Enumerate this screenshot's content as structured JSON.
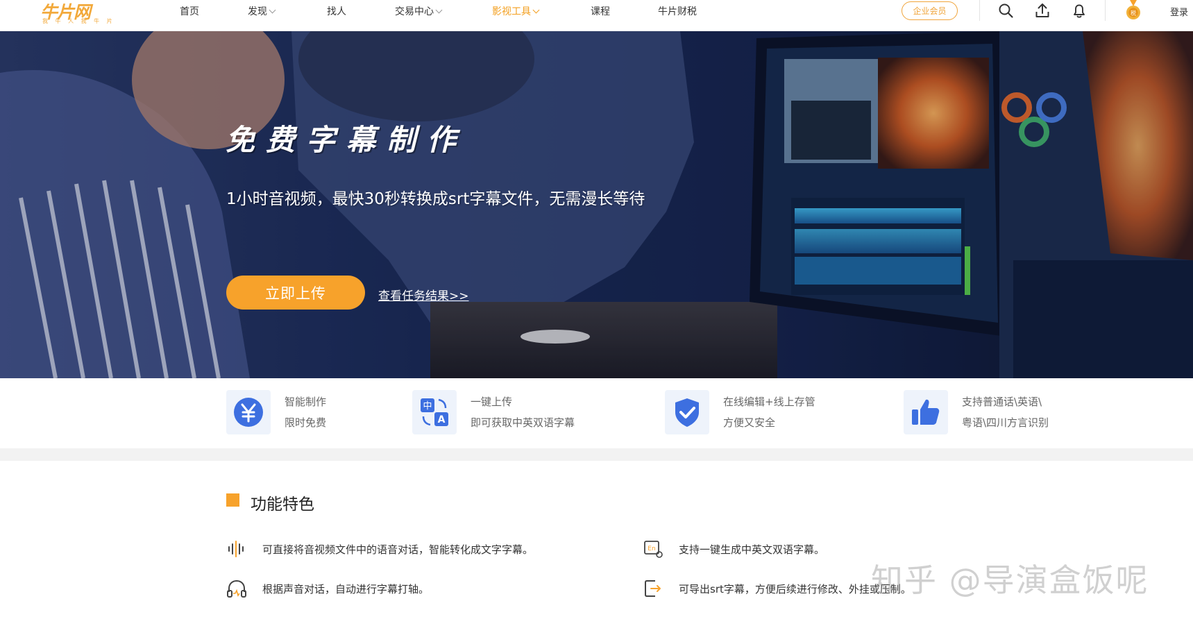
{
  "logo": {
    "name": "牛片网",
    "tagline": "我 牛 人 我 牛 片"
  },
  "nav": {
    "items": [
      {
        "label": "首页"
      },
      {
        "label": "发现"
      },
      {
        "label": "找人"
      },
      {
        "label": "交易中心"
      },
      {
        "label": "影视工具"
      },
      {
        "label": "课程"
      },
      {
        "label": "牛片财税"
      }
    ],
    "active": "影视工具",
    "vip_label": "企业会员",
    "login_label": "登录",
    "icons": [
      "search-icon",
      "upload-icon",
      "bell-icon",
      "medal-icon"
    ]
  },
  "banner": {
    "title": "免费字幕制作",
    "subtitle": "1小时音视频，最快30秒转换成srt字幕文件，无需漫长等待",
    "upload_label": "立即上传",
    "result_link": "查看任务结果>>"
  },
  "features": [
    {
      "icon": "yen-icon",
      "line1": "智能制作",
      "line2": "限时免费"
    },
    {
      "icon": "translate-icon",
      "line1": "一键上传",
      "line2": "即可获取中英双语字幕"
    },
    {
      "icon": "shield-check-icon",
      "line1": "在线编辑+线上存管",
      "line2": "方便又安全"
    },
    {
      "icon": "thumbs-up-icon",
      "line1": "支持普通话\\英语\\",
      "line2": "粤语\\四川方言识别"
    }
  ],
  "section": {
    "title": "功能特色",
    "items": [
      {
        "icon": "audio-wave-icon",
        "text": "可直接将音视频文件中的语音对话，智能转化成文字字幕。"
      },
      {
        "icon": "bilingual-icon",
        "text": "支持一键生成中英文双语字幕。"
      },
      {
        "icon": "headphones-icon",
        "text": "根据声音对话，自动进行字幕打轴。"
      },
      {
        "icon": "export-icon",
        "text": "可导出srt字幕，方便后续进行修改、外挂或压制。"
      }
    ]
  },
  "watermark": "知乎 @导演盒饭呢",
  "colors": {
    "accent": "#f7a22b",
    "feature_icon_bg": "#eef3fb",
    "feature_icon_fg": "#3d6fe0"
  }
}
